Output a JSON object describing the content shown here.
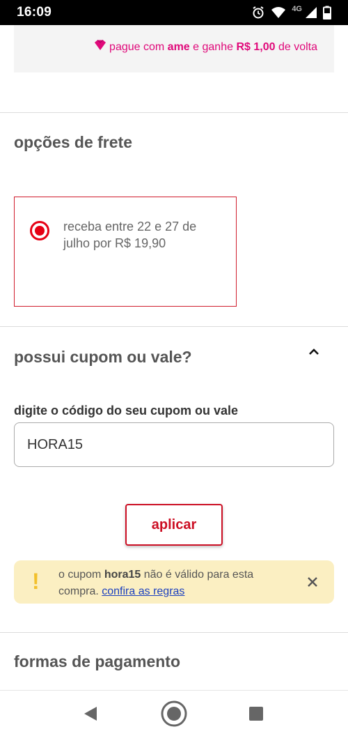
{
  "status_bar": {
    "time": "16:09",
    "network": "4G",
    "icons": [
      "alarm-icon",
      "wifi-icon",
      "signal-icon",
      "battery-icon"
    ]
  },
  "promo": {
    "prefix": "pague com ",
    "brand": "ame",
    "middle": " e ganhe ",
    "amount": "R$ 1,00",
    "suffix": " de volta",
    "color": "#e0097a"
  },
  "shipping": {
    "title": "opções de frete",
    "option_text": "receba entre 22 e 27 de julho por R$ 19,90",
    "selected": true
  },
  "coupon": {
    "title": "possui cupom ou vale?",
    "field_label": "digite o código do seu cupom ou vale",
    "field_value": "HORA15",
    "apply_label": "aplicar",
    "alert": {
      "prefix": "o cupom ",
      "code": "hora15",
      "middle": " não é válido para esta compra. ",
      "link": "confira as regras",
      "icon": "!"
    }
  },
  "payment": {
    "title": "formas de pagamento"
  },
  "colors": {
    "accent": "#cc0f24",
    "brand_pink": "#e0097a",
    "alert_bg": "#fbefc2",
    "link": "#1a3fbf"
  }
}
